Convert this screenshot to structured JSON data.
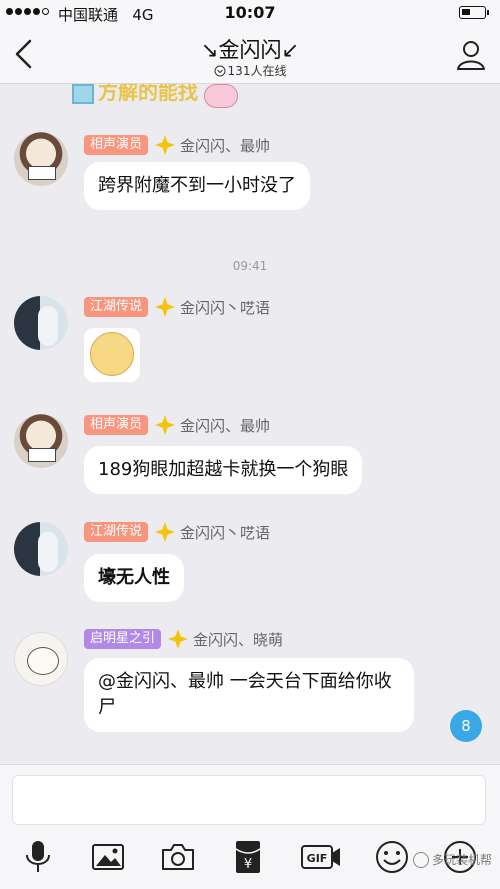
{
  "status_bar": {
    "carrier": "中国联通",
    "network": "4G",
    "time": "10:07"
  },
  "nav": {
    "title": "↘金闪闪↙",
    "online": "131人在线"
  },
  "messages": [
    {
      "tag": "相声演员",
      "name": "金闪闪、最帅",
      "text": "跨界附魔不到一小时没了"
    },
    {
      "timestamp": "09:41"
    },
    {
      "tag": "江湖传说",
      "name": "金闪闪丶呓语",
      "sticker": true
    },
    {
      "tag": "相声演员",
      "name": "金闪闪、最帅",
      "text": "189狗眼加超越卡就换一个狗眼"
    },
    {
      "tag": "江湖传说",
      "name": "金闪闪丶呓语",
      "text": "壕无人性"
    },
    {
      "tag": "启明星之引",
      "name": "金闪闪、晓萌",
      "text": "@金闪闪、最帅 一会天台下面给你收尸"
    }
  ],
  "unread_count": "8",
  "watermark": "多玩装机帮",
  "colors": {
    "tag_orange": "#f7957f",
    "tag_purple": "#b18ae8",
    "badge": "#3aa7e6"
  },
  "icons": [
    "microphone-icon",
    "image-icon",
    "camera-icon",
    "red-packet-icon",
    "gif-icon",
    "emoji-icon",
    "plus-icon"
  ]
}
